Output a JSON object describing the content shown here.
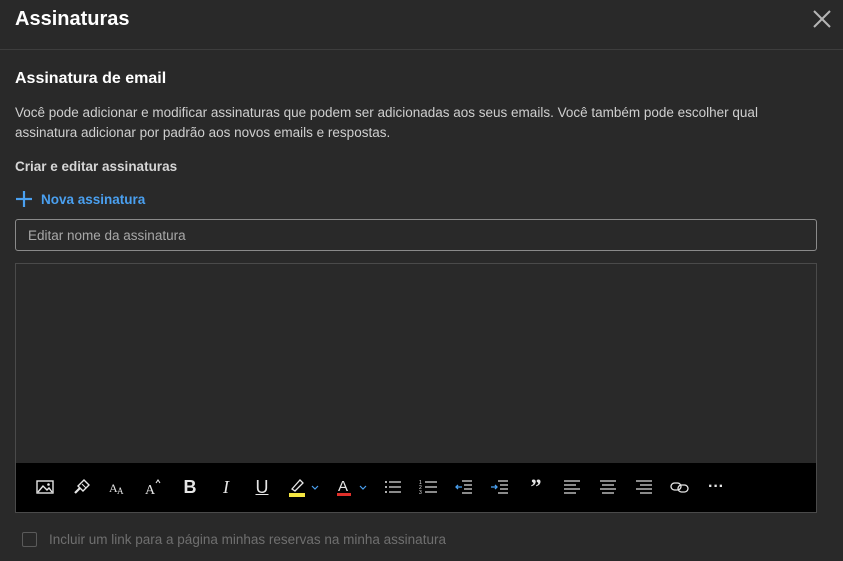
{
  "header": {
    "title": "Assinaturas"
  },
  "signature": {
    "section_title": "Assinatura de email",
    "description": "Você pode adicionar e modificar assinaturas que podem ser adicionadas aos seus emails. Você também pode escolher qual assinatura adicionar por padrão aos novos emails e respostas.",
    "subsection_title": "Criar e editar assinaturas",
    "new_signature_label": "Nova assinatura",
    "name_input": {
      "placeholder": "Editar nome da assinatura",
      "value": ""
    }
  },
  "toolbar": {
    "bold_label": "B",
    "italic_label": "I",
    "underline_label": "U",
    "quote_label": "”",
    "more_label": "···",
    "highlight_color": "#f5e642",
    "font_color": "#e0302a",
    "dropdown_color": "#4aa0f0"
  },
  "footer": {
    "checkbox_label": "Incluir um link para a página minhas reservas na minha assinatura",
    "checkbox_checked": false
  },
  "colors": {
    "background": "#292929",
    "accent": "#4aa0f0",
    "toolbar_bg": "#000000"
  }
}
